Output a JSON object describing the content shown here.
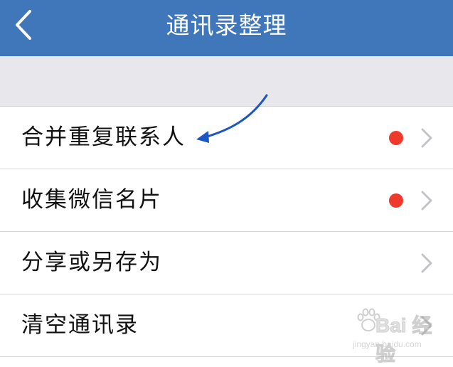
{
  "navbar": {
    "title": "通讯录整理",
    "back_icon": "chevron-left-icon",
    "background_color": "#4076ba"
  },
  "list": {
    "items": [
      {
        "label": "合并重复联系人",
        "has_badge": true
      },
      {
        "label": "收集微信名片",
        "has_badge": true
      },
      {
        "label": "分享或另存为",
        "has_badge": false
      },
      {
        "label": "清空通讯录",
        "has_badge": false
      }
    ],
    "badge_color": "#f0392d",
    "chevron_icon": "chevron-right-icon"
  },
  "annotation": {
    "type": "blue-curved-arrow",
    "target": "合并重复联系人",
    "color": "#1c56c4"
  },
  "watermark": {
    "brand": "Bai 经验",
    "url": "jingyan.baidu.com"
  }
}
